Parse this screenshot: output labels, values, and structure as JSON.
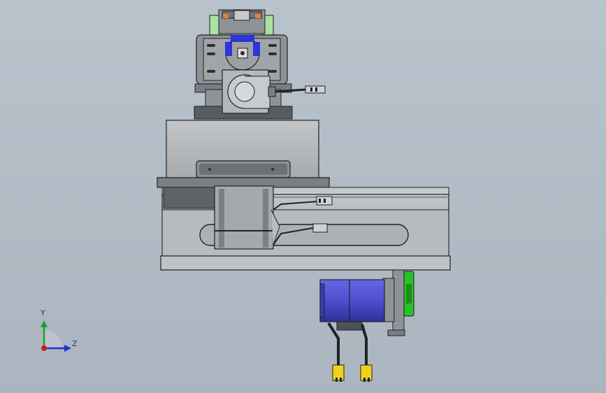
{
  "viewport": {
    "background_top": "#b9c3cc",
    "background_bottom": "#aab5bf"
  },
  "triad": {
    "y_label": "Y",
    "z_label": "Z",
    "y_color": "#18a32b",
    "z_color": "#2232c8",
    "x_color": "#d41a1a"
  },
  "colors": {
    "steel_light": "#b4b7ba",
    "steel_mid": "#8f9296",
    "steel_dark": "#4e5155",
    "outline": "#1f2226",
    "motor_blue": "#4d4fd0",
    "pulley_green": "#29c225",
    "connector_yellow": "#f1d21b",
    "highlight_blue": "#2b35d8",
    "spring_green": "#a9e3a1",
    "accent_orange": "#f07f1e"
  }
}
